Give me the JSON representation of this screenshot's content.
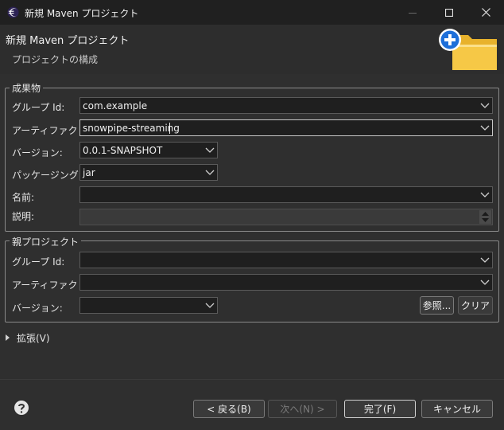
{
  "window": {
    "title": "新規 Maven プロジェクト"
  },
  "header": {
    "title": "新規 Maven プロジェクト",
    "subtitle": "プロジェクトの構成",
    "icon": "folder-add-icon"
  },
  "artifact": {
    "legend": "成果物",
    "group_label": "グループ Id:",
    "group_value": "com.example",
    "artifact_label": "アーティファクト Id:",
    "artifact_value": "snowpipe-streaming",
    "version_label": "バージョン:",
    "version_value": "0.0.1-SNAPSHOT",
    "packaging_label": "パッケージング:",
    "packaging_value": "jar",
    "name_label": "名前:",
    "name_value": "",
    "desc_label": "説明:",
    "desc_value": ""
  },
  "parent": {
    "legend": "親プロジェクト",
    "group_label": "グループ Id:",
    "group_value": "",
    "artifact_label": "アーティファクト Id:",
    "artifact_value": "",
    "version_label": "バージョン:",
    "version_value": "",
    "browse_label": "参照...",
    "clear_label": "クリア"
  },
  "advanced": {
    "label": "拡張(V)"
  },
  "footer": {
    "back_label": "< 戻る(B)",
    "next_label": "次へ(N) >",
    "finish_label": "完了(F)",
    "cancel_label": "キャンセル"
  },
  "colors": {
    "background": "#2f2f2f",
    "titlebar": "#202020",
    "input": "#1f1f1f",
    "folder": "#f6c846",
    "plus": "#1e6fd9"
  }
}
